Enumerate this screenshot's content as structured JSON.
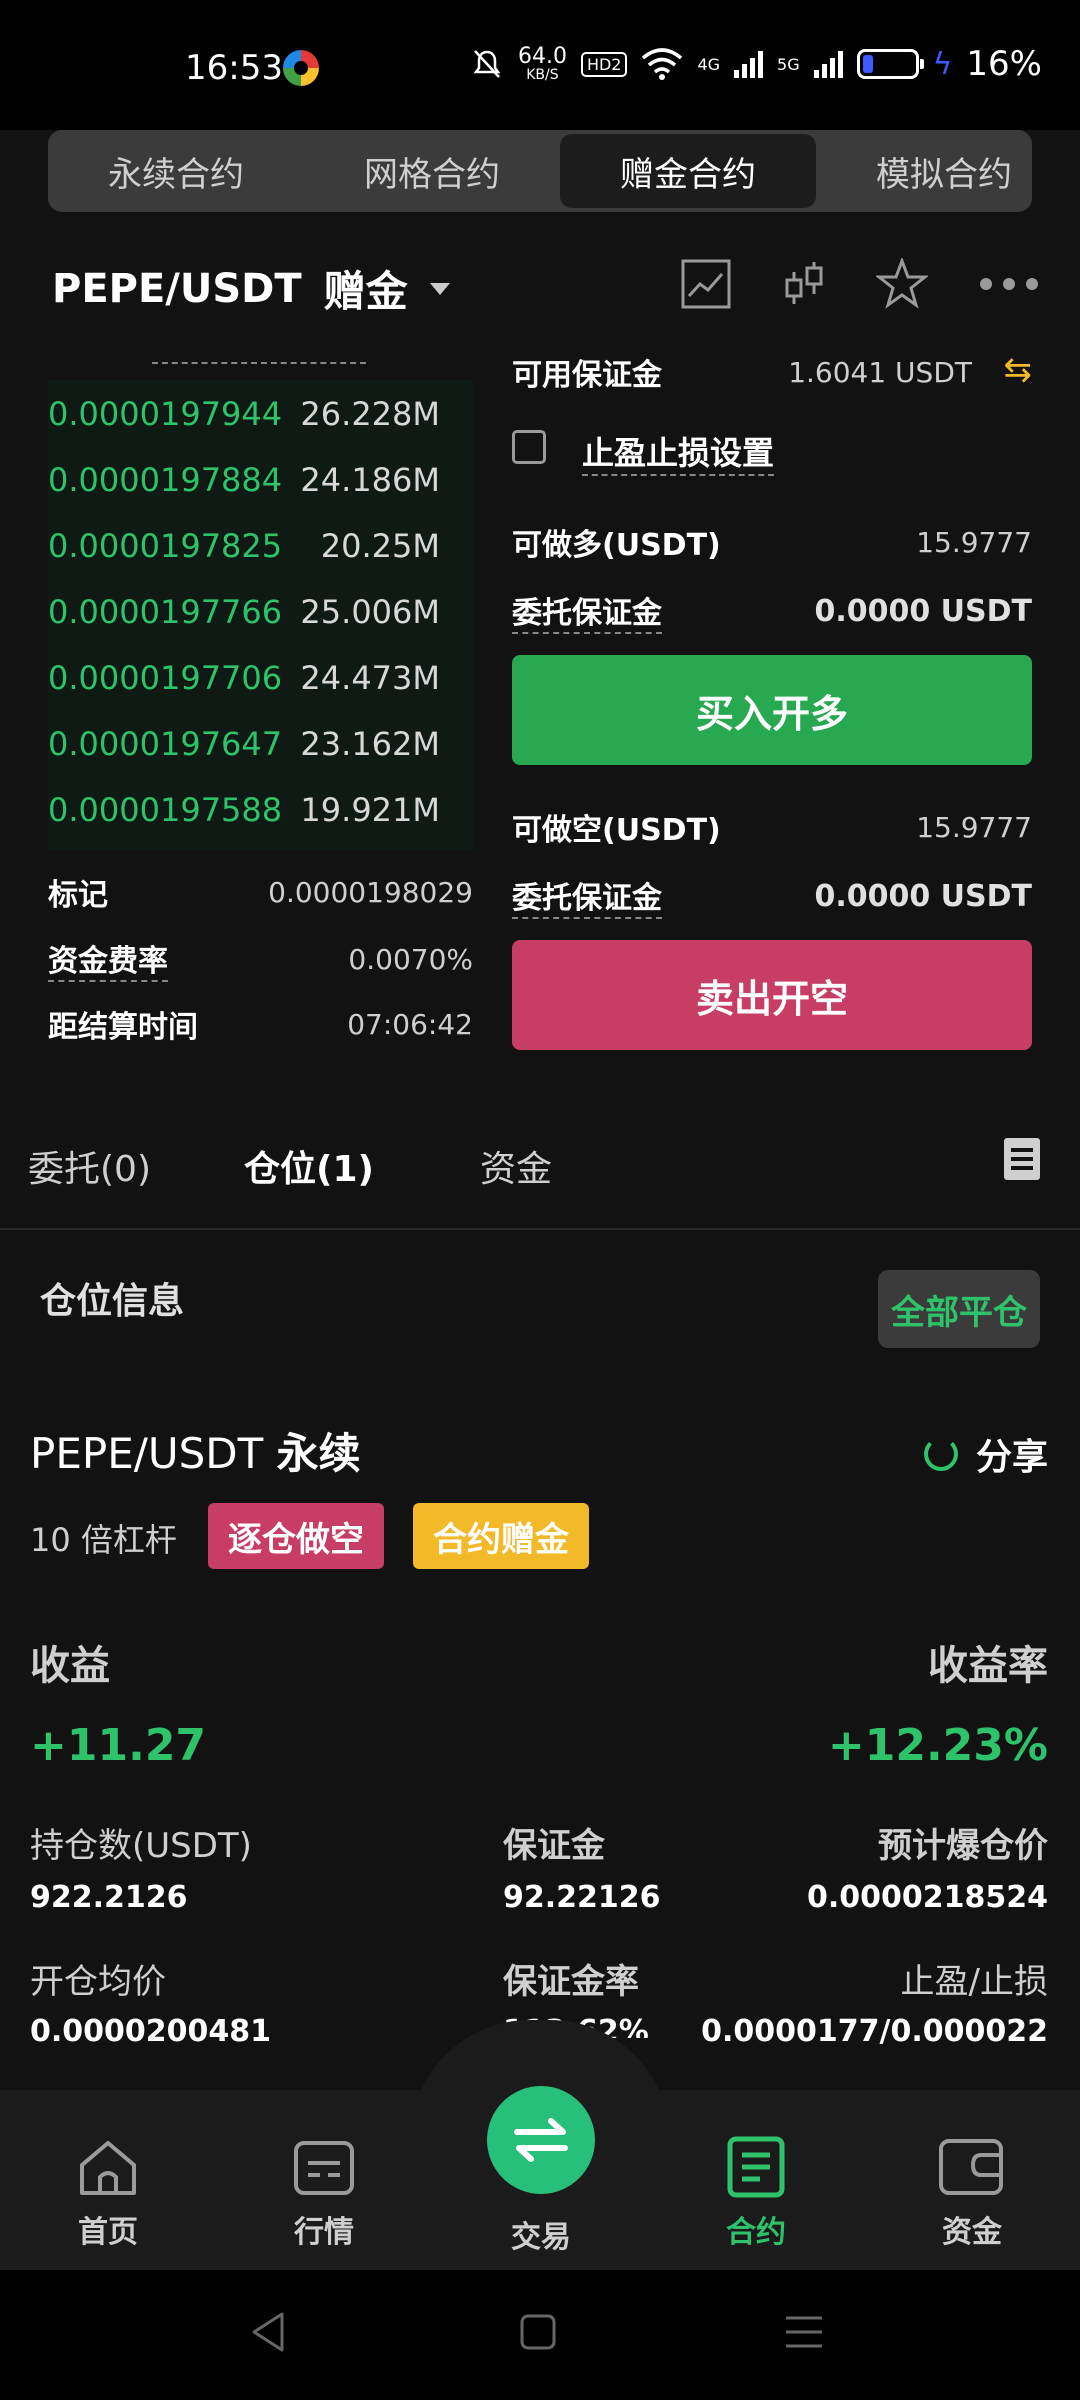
{
  "status_bar": {
    "time": "16:53",
    "net_speed_value": "64.0",
    "net_speed_unit": "KB/S",
    "hd_label": "HD2",
    "net_4g": "4G",
    "net_5g": "5G",
    "battery_percent": "16%",
    "battery_level": 0.16,
    "icons": [
      "app-icon",
      "mute-icon",
      "wifi-icon",
      "signal-icon",
      "battery-icon",
      "charging-icon"
    ]
  },
  "contract_tabs": [
    {
      "label": "永续合约",
      "active": false
    },
    {
      "label": "网格合约",
      "active": false
    },
    {
      "label": "赠金合约",
      "active": true
    },
    {
      "label": "模拟合约",
      "active": false
    }
  ],
  "header": {
    "pair": "PEPE/USDT",
    "tag": "赠金",
    "icons": [
      "chart-icon",
      "candlestick-icon",
      "star-icon",
      "more-icon"
    ]
  },
  "order_book": {
    "rows": [
      {
        "price": "0.0000197944",
        "qty": "26.228M"
      },
      {
        "price": "0.0000197884",
        "qty": "24.186M"
      },
      {
        "price": "0.0000197825",
        "qty": "20.25M"
      },
      {
        "price": "0.0000197766",
        "qty": "25.006M"
      },
      {
        "price": "0.0000197706",
        "qty": "24.473M"
      },
      {
        "price": "0.0000197647",
        "qty": "23.162M"
      },
      {
        "price": "0.0000197588",
        "qty": "19.921M"
      }
    ],
    "mark_label": "标记",
    "mark_value": "0.0000198029",
    "funding_label": "资金费率",
    "funding_value": "0.0070%",
    "settle_label": "距结算时间",
    "settle_value": "07:06:42"
  },
  "trade_panel": {
    "available_label": "可用保证金",
    "available_value": "1.6041 USDT",
    "tpsl_label": "止盈止损设置",
    "long_max_label": "可做多(USDT)",
    "long_max_value": "15.9777",
    "long_margin_label": "委托保证金",
    "long_margin_value": "0.0000 USDT",
    "buy_button": "买入开多",
    "short_max_label": "可做空(USDT)",
    "short_max_value": "15.9777",
    "short_margin_label": "委托保证金",
    "short_margin_value": "0.0000 USDT",
    "sell_button": "卖出开空"
  },
  "order_tabs": [
    {
      "label": "委托(0)",
      "active": false
    },
    {
      "label": "仓位(1)",
      "active": true
    },
    {
      "label": "资金",
      "active": false
    }
  ],
  "position": {
    "section_title": "仓位信息",
    "close_all": "全部平仓",
    "pair": "PEPE/USDT",
    "pair_type": "永续",
    "share": "分享",
    "leverage": "10 倍杠杆",
    "badge_mode": "逐仓做空",
    "badge_bonus": "合约赠金",
    "pnl_label": "收益",
    "pnl_value": "+11.27",
    "roe_label": "收益率",
    "roe_value": "+12.23%",
    "size_label": "持仓数(USDT)",
    "size_value": "922.2126",
    "margin_label": "保证金",
    "margin_value": "92.22126",
    "liq_label": "预计爆仓价",
    "liq_value": "0.0000218524",
    "entry_label": "开仓均价",
    "entry_value": "0.0000200481",
    "margin_ratio_label": "保证金率",
    "margin_ratio_value": "113.62%",
    "tpsl_label": "止盈/止损",
    "tpsl_value": "0.0000177/0.000022"
  },
  "bottom_nav": [
    {
      "label": "首页",
      "icon": "home-icon",
      "active": false
    },
    {
      "label": "行情",
      "icon": "market-icon",
      "active": false
    },
    {
      "label": "交易",
      "icon": "swap-icon",
      "active": false
    },
    {
      "label": "合约",
      "icon": "contract-icon",
      "active": true
    },
    {
      "label": "资金",
      "icon": "wallet-icon",
      "active": false
    }
  ],
  "colors": {
    "green": "#2ec36a",
    "red": "#c83d64",
    "buy_green": "#28a951",
    "yellow": "#f2b928",
    "background": "#121212"
  }
}
